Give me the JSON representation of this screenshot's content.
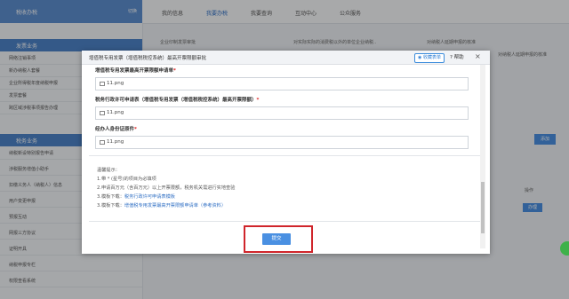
{
  "sidebar": {
    "header": {
      "title": "税收办税",
      "right": "切换"
    },
    "sections": [
      {
        "label": "发票业务"
      },
      {
        "label": "税务业务"
      }
    ],
    "items_a": [
      "网络注销事项",
      "新办纳税人套餐",
      "企业所得税年度纳税申报",
      "发票套餐",
      "跨区域涉税事项报告办理"
    ],
    "items_b": [
      "纳税新设特别报告申请",
      "涉税服务增值小助手",
      "扣缴义务人（纳税人）信息",
      "用户变更申报",
      "预报互动",
      "网报三方协议",
      "证明开具",
      "纳税申报专栏",
      "权限查看系统"
    ]
  },
  "topnav": {
    "tabs": [
      "我的信息",
      "我要办税",
      "我要查询",
      "互动中心",
      "公众服务"
    ]
  },
  "background": {
    "row1": [
      "企业印制发票审批",
      "对实际实际的消费税以外的单位企业纳税..",
      "对纳税人延期申报的核准"
    ],
    "row2": "对纳税人延期申报的核准",
    "apply_label": "添加",
    "table_col": "操作",
    "open_label": "办理"
  },
  "modal": {
    "title": "增值税专用发票（增值税税控系统）最高开票限额审批",
    "fav_label": "收藏表单",
    "help_label": "帮助",
    "close_label": "×",
    "fields": [
      {
        "label": "增值税专用发票最高开票限额申请单",
        "file": "11.png"
      },
      {
        "label": "税务行政许可申请表（增值税专用发票（增值税税控系统）最高开票限额）",
        "file": "11.png"
      },
      {
        "label": "经办人身份证原件",
        "file": "11.png"
      }
    ],
    "required_mark": "*",
    "tips": {
      "title": "温馨提示：",
      "line1": "1.带 * (星号)的项目为必填项",
      "line2": "2.申请百万元（含百万元）以上开票限额，税务机关需进行实地查验",
      "line3_prefix": "3.模板下载：",
      "line3_link": "税务行政许可申请表模板",
      "line4_prefix": "3.模板下载：",
      "line4_link": "增值税专用发票最高开票限额申请单（参考资料）"
    },
    "submit_label": "提交"
  }
}
